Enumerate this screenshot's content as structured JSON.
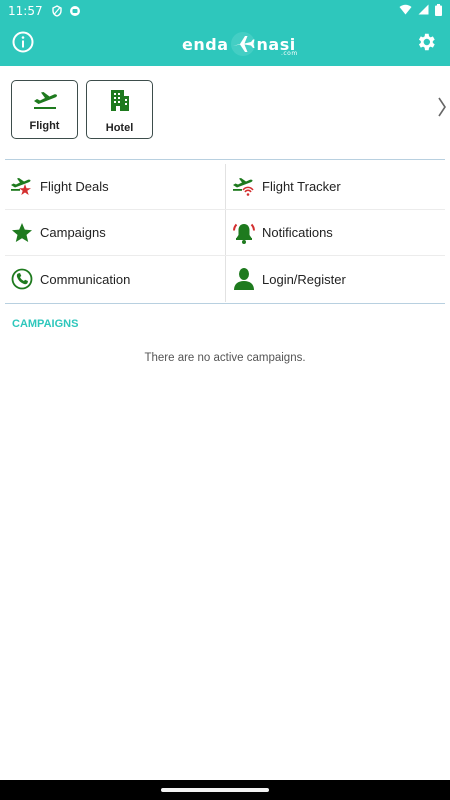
{
  "status_bar": {
    "time": "11:57"
  },
  "app_bar": {
    "logo_left": "enda",
    "logo_right": "nasi",
    "logo_suffix": ".com"
  },
  "services": [
    {
      "label": "Flight",
      "icon": "airplane-takeoff-icon"
    },
    {
      "label": "Hotel",
      "icon": "building-icon"
    }
  ],
  "menu": {
    "flight_deals": "Flight Deals",
    "flight_tracker": "Flight Tracker",
    "campaigns": "Campaigns",
    "notifications": "Notifications",
    "communication": "Communication",
    "login_register": "Login/Register"
  },
  "campaigns_section": {
    "title": "CAMPAIGNS",
    "empty_message": "There are no active campaigns."
  },
  "colors": {
    "primary": "#2ec7bc",
    "icon_green": "#1e7a1e",
    "accent_red": "#d32f2f"
  }
}
